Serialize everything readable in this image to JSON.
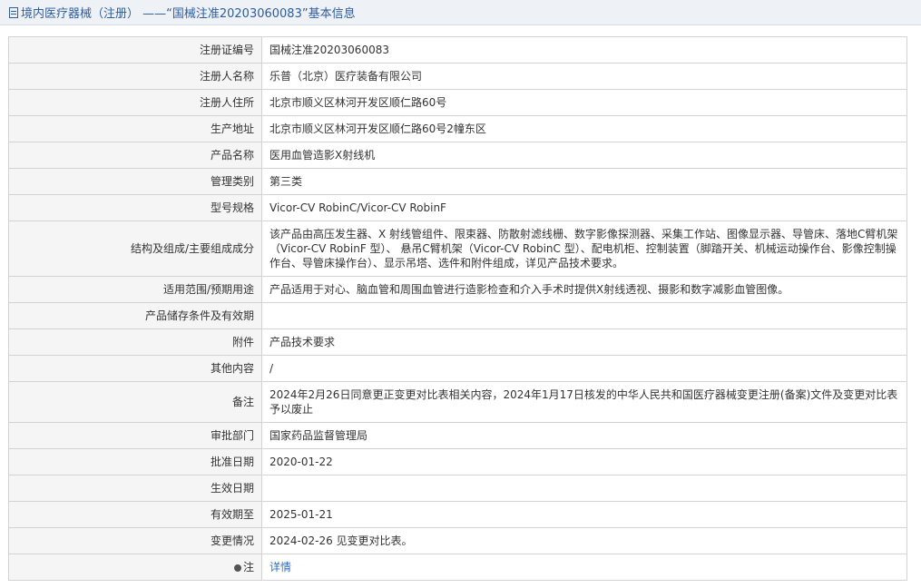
{
  "header": {
    "title": "境内医疗器械（注册） ——“国械注准20203060083”基本信息"
  },
  "rows": [
    {
      "label": "注册证编号",
      "value": "国械注准20203060083"
    },
    {
      "label": "注册人名称",
      "value": "乐普（北京）医疗装备有限公司"
    },
    {
      "label": "注册人住所",
      "value": "北京市顺义区林河开发区顺仁路60号"
    },
    {
      "label": "生产地址",
      "value": "北京市顺义区林河开发区顺仁路60号2幢东区"
    },
    {
      "label": "产品名称",
      "value": "医用血管造影X射线机"
    },
    {
      "label": "管理类别",
      "value": "第三类"
    },
    {
      "label": "型号规格",
      "value": "Vicor-CV RobinC/Vicor-CV RobinF"
    },
    {
      "label": "结构及组成/主要组成成分",
      "value": "该产品由高压发生器、X 射线管组件、限束器、防散射滤线栅、数字影像探测器、采集工作站、图像显示器、导管床、落地C臂机架（Vicor-CV RobinF 型）、 悬吊C臂机架（Vicor-CV RobinC 型）、配电机柜、控制装置（脚踏开关、机械运动操作台、影像控制操作台、导管床操作台）、显示吊塔、选件和附件组成，详见产品技术要求。"
    },
    {
      "label": "适用范围/预期用途",
      "value": "产品适用于对心、脑血管和周围血管进行造影检查和介入手术时提供X射线透视、摄影和数字减影血管图像。"
    },
    {
      "label": "产品储存条件及有效期",
      "value": ""
    },
    {
      "label": "附件",
      "value": "产品技术要求"
    },
    {
      "label": "其他内容",
      "value": "/"
    },
    {
      "label": "备注",
      "value": "2024年2月26日同意更正变更对比表相关内容，2024年1月17日核发的中华人民共和国医疗器械变更注册(备案)文件及变更对比表予以废止"
    },
    {
      "label": "审批部门",
      "value": "国家药品监督管理局"
    },
    {
      "label": "批准日期",
      "value": "2020-01-22"
    },
    {
      "label": "生效日期",
      "value": ""
    },
    {
      "label": "有效期至",
      "value": "2025-01-21"
    },
    {
      "label": "变更情况",
      "value": "2024-02-26 见变更对比表。"
    },
    {
      "label": "注",
      "value": "详情",
      "icon": "info-dot-icon"
    }
  ]
}
